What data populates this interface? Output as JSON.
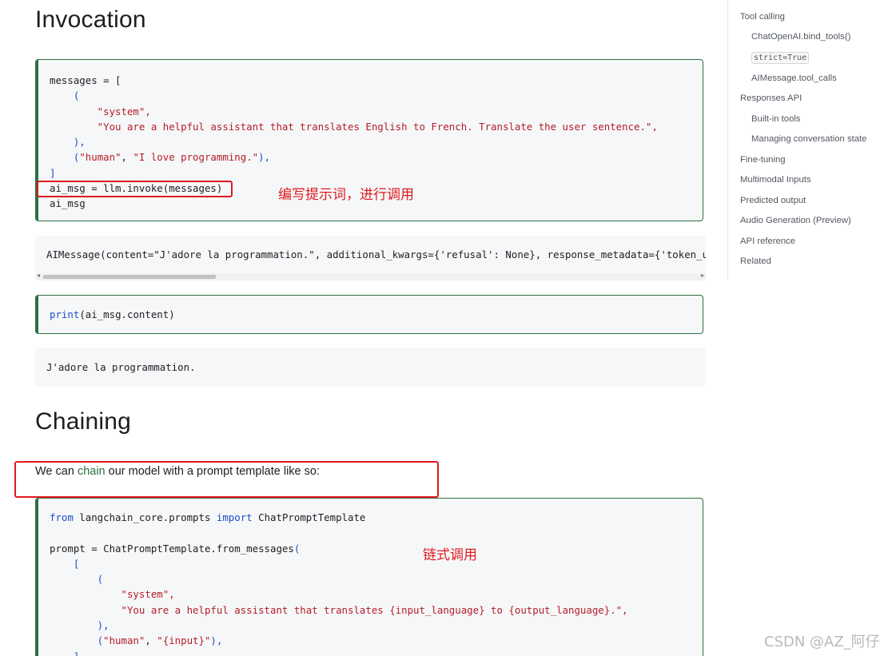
{
  "sections": {
    "invocation_title": "Invocation",
    "chaining_title": "Chaining"
  },
  "invoke_code": {
    "l1": "messages = [",
    "l2": "    (",
    "l3": "        \"system\",",
    "l4": "        \"You are a helpful assistant that translates English to French. Translate the user sentence.\",",
    "l5": "    ),",
    "l6_a": "    (",
    "l6_b": "\"human\"",
    "l6_c": ", ",
    "l6_d": "\"I love programming.\"",
    "l6_e": "),",
    "l7": "]",
    "l8": "ai_msg = llm.invoke(messages)",
    "l9": "ai_msg"
  },
  "output1": "AIMessage(content=\"J'adore la programmation.\", additional_kwargs={'refusal': None}, response_metadata={'token_usa",
  "print_code": {
    "fn": "print",
    "args": "(ai_msg.content)"
  },
  "output2": "J'adore la programmation.",
  "paragraph": {
    "before": "We can ",
    "link": "chain",
    "after": " our model with a prompt template like so:"
  },
  "chain_code": {
    "l1_kw1": "from",
    "l1_mod": " langchain_core.prompts ",
    "l1_kw2": "import",
    "l1_name": " ChatPromptTemplate",
    "l3_a": "prompt = ChatPromptTemplate.from_messages",
    "l3_b": "(",
    "l4": "    [",
    "l5": "        (",
    "l6": "            \"system\",",
    "l7": "            \"You are a helpful assistant that translates {input_language} to {output_language}.\",",
    "l8": "        ),",
    "l9_a": "        (",
    "l9_b": "\"human\"",
    "l9_c": ", ",
    "l9_d": "\"{input}\"",
    "l9_e": "),",
    "l10": "    ]"
  },
  "annotations": {
    "invoke_note": "编写提示词，进行调用",
    "chain_note": "链式调用"
  },
  "toc": {
    "items": [
      "Tool calling",
      "ChatOpenAI.bind_tools()",
      "strict=True",
      "AIMessage.tool_calls",
      "Responses API",
      "Built-in tools",
      "Managing conversation state",
      "Fine-tuning",
      "Multimodal Inputs",
      "Predicted output",
      "Audio Generation (Preview)",
      "API reference",
      "Related"
    ]
  },
  "watermark": "CSDN @AZ_阿仔",
  "colors": {
    "accent_green": "#2e6f40",
    "annotation_red": "#e0191f",
    "string_red": "#b31d28",
    "keyword_blue": "#1a4fc9"
  }
}
